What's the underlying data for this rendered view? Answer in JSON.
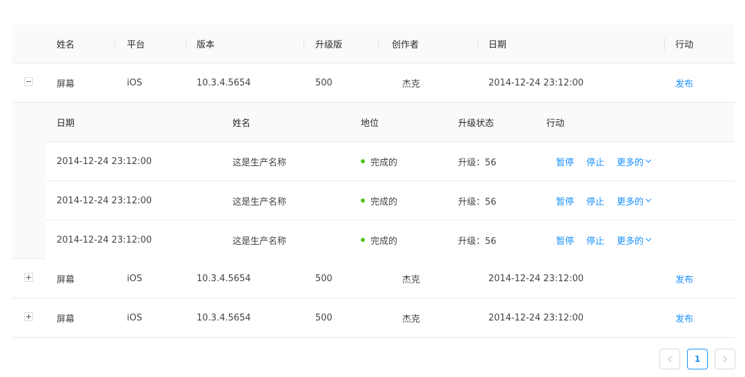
{
  "table": {
    "headers": {
      "name": "姓名",
      "platform": "平台",
      "version": "版本",
      "upgrade": "升级版",
      "creator": "创作者",
      "date": "日期",
      "action": "行动"
    },
    "rows": [
      {
        "name": "屏幕",
        "platform": "iOS",
        "version": "10.3.4.5654",
        "upgrade": "500",
        "creator": "杰克",
        "date": "2014-12-24 23:12:00",
        "action": "发布"
      },
      {
        "name": "屏幕",
        "platform": "iOS",
        "version": "10.3.4.5654",
        "upgrade": "500",
        "creator": "杰克",
        "date": "2014-12-24 23:12:00",
        "action": "发布"
      },
      {
        "name": "屏幕",
        "platform": "iOS",
        "version": "10.3.4.5654",
        "upgrade": "500",
        "creator": "杰克",
        "date": "2014-12-24 23:12:00",
        "action": "发布"
      }
    ]
  },
  "nested": {
    "headers": {
      "date": "日期",
      "name": "姓名",
      "status": "地位",
      "upgrade_status": "升级状态",
      "action": "行动"
    },
    "status_color": "#52c41a",
    "link_color": "#1890ff",
    "rows": [
      {
        "date": "2014-12-24 23:12:00",
        "name": "这是生产名称",
        "status": "完成的",
        "upgrade": "升级：56",
        "pause": "暂停",
        "stop": "停止",
        "more": "更多的"
      },
      {
        "date": "2014-12-24 23:12:00",
        "name": "这是生产名称",
        "status": "完成的",
        "upgrade": "升级：56",
        "pause": "暂停",
        "stop": "停止",
        "more": "更多的"
      },
      {
        "date": "2014-12-24 23:12:00",
        "name": "这是生产名称",
        "status": "完成的",
        "upgrade": "升级：56",
        "pause": "暂停",
        "stop": "停止",
        "more": "更多的"
      }
    ]
  },
  "pagination": {
    "current": "1",
    "prev_icon": "chevron-left-icon",
    "next_icon": "chevron-right-icon"
  }
}
